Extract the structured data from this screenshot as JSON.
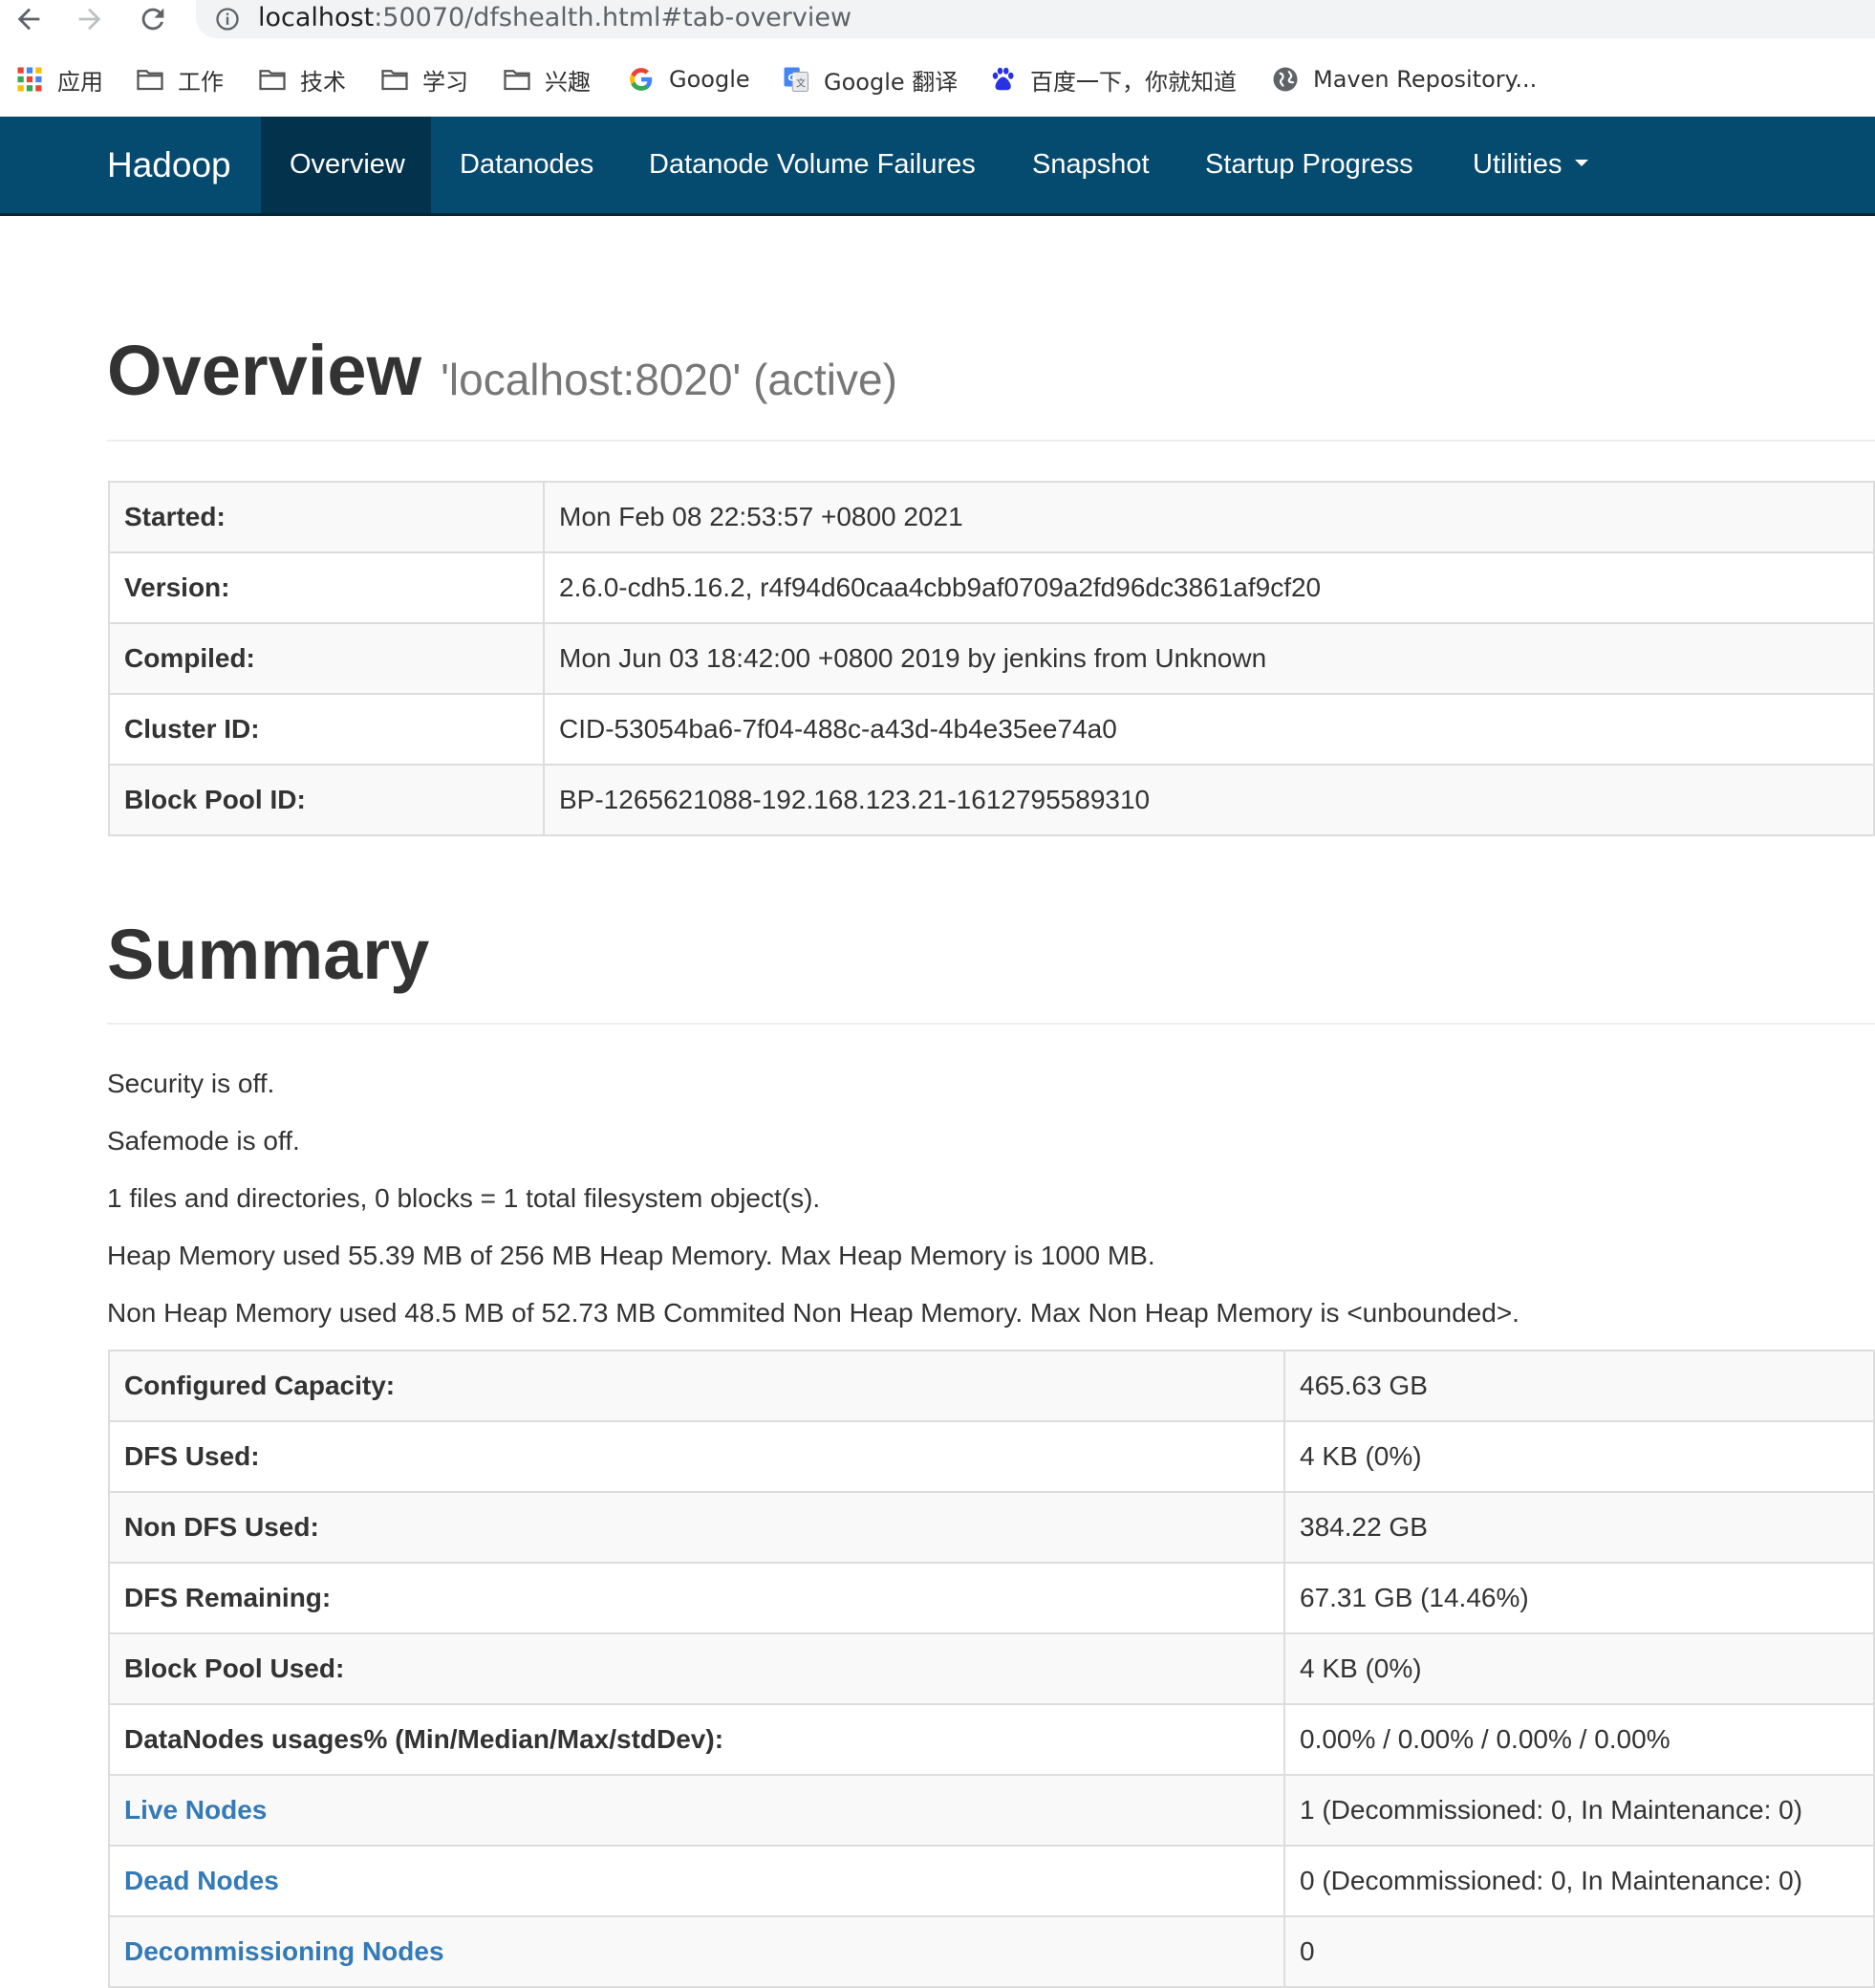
{
  "browser": {
    "url_host": "localhost",
    "url_rest": ":50070/dfshealth.html#tab-overview",
    "bookmarks": [
      {
        "label": "应用",
        "icon": "apps-grid-icon"
      },
      {
        "label": "工作",
        "icon": "folder-icon"
      },
      {
        "label": "技术",
        "icon": "folder-icon"
      },
      {
        "label": "学习",
        "icon": "folder-icon"
      },
      {
        "label": "兴趣",
        "icon": "folder-icon"
      },
      {
        "label": "Google",
        "icon": "google-icon"
      },
      {
        "label": "Google 翻译",
        "icon": "google-translate-icon"
      },
      {
        "label": "百度一下，你就知道",
        "icon": "baidu-paw-icon"
      },
      {
        "label": "Maven Repository...",
        "icon": "globe-icon"
      }
    ]
  },
  "navbar": {
    "brand": "Hadoop",
    "items": [
      "Overview",
      "Datanodes",
      "Datanode Volume Failures",
      "Snapshot",
      "Startup Progress",
      "Utilities"
    ],
    "active": "Overview",
    "color": "#054a6f"
  },
  "overview": {
    "title": "Overview",
    "subtitle": "'localhost:8020' (active)",
    "rows": [
      {
        "key": "Started:",
        "value": "Mon Feb 08 22:53:57 +0800 2021"
      },
      {
        "key": "Version:",
        "value": "2.6.0-cdh5.16.2, r4f94d60caa4cbb9af0709a2fd96dc3861af9cf20"
      },
      {
        "key": "Compiled:",
        "value": "Mon Jun 03 18:42:00 +0800 2019 by jenkins from Unknown"
      },
      {
        "key": "Cluster ID:",
        "value": "CID-53054ba6-7f04-488c-a43d-4b4e35ee74a0"
      },
      {
        "key": "Block Pool ID:",
        "value": "BP-1265621088-192.168.123.21-1612795589310"
      }
    ]
  },
  "summary": {
    "title": "Summary",
    "lines": [
      "Security is off.",
      "Safemode is off.",
      "1 files and directories, 0 blocks = 1 total filesystem object(s).",
      "Heap Memory used 55.39 MB of 256 MB Heap Memory. Max Heap Memory is 1000 MB.",
      "Non Heap Memory used 48.5 MB of 52.73 MB Commited Non Heap Memory. Max Non Heap Memory is <unbounded>."
    ],
    "rows": [
      {
        "key": "Configured Capacity:",
        "value": "465.63 GB",
        "link": false
      },
      {
        "key": "DFS Used:",
        "value": "4 KB (0%)",
        "link": false
      },
      {
        "key": "Non DFS Used:",
        "value": "384.22 GB",
        "link": false
      },
      {
        "key": "DFS Remaining:",
        "value": "67.31 GB (14.46%)",
        "link": false
      },
      {
        "key": "Block Pool Used:",
        "value": "4 KB (0%)",
        "link": false
      },
      {
        "key": "DataNodes usages% (Min/Median/Max/stdDev):",
        "value": "0.00% / 0.00% / 0.00% / 0.00%",
        "link": false
      },
      {
        "key": "Live Nodes",
        "value": "1 (Decommissioned: 0, In Maintenance: 0)",
        "link": true
      },
      {
        "key": "Dead Nodes",
        "value": "0 (Decommissioned: 0, In Maintenance: 0)",
        "link": true
      },
      {
        "key": "Decommissioning Nodes",
        "value": "0",
        "link": true
      }
    ]
  }
}
